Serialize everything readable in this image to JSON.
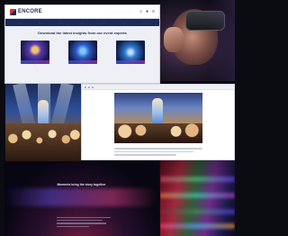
{
  "site": {
    "logo_text": "ENCORE",
    "header_links": [
      "· · · · · · · ·",
      "· · · · · · · ·"
    ],
    "nav_items": [
      "· · ·",
      "· · ·",
      "· · ·",
      "· · ·",
      "· · ·",
      "· · ·",
      "· · ·"
    ],
    "headline": "Download the latest insights from our event experts",
    "card_labels": [
      "· · ·",
      "· · ·",
      "· · ·"
    ]
  },
  "hero": {
    "title": "Moments bring the story together"
  },
  "icons": {
    "search": "search-icon",
    "menu": "menu-icon",
    "user": "user-icon"
  },
  "colors": {
    "brand_navy": "#1d2a5c",
    "brand_red": "#e1302a"
  }
}
